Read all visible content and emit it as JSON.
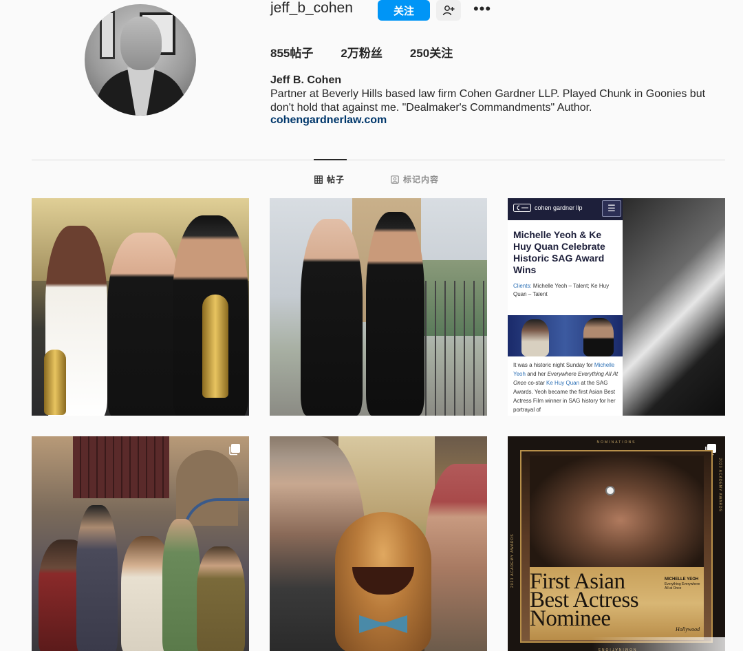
{
  "profile": {
    "username": "jeff_b_cohen",
    "follow_label": "关注",
    "stats": {
      "posts_count": "855",
      "posts_label": "帖子",
      "followers_count": "2万",
      "followers_label": "粉丝",
      "following_count": "250",
      "following_label": "关注"
    },
    "full_name": "Jeff B. Cohen",
    "bio": "Partner at Beverly Hills based law firm Cohen Gardner LLP. Played Chunk in Goonies but don't hold that against me. \"Dealmaker's Commandments\" Author.",
    "website": "cohengardnerlaw.com"
  },
  "tabs": [
    {
      "label": "帖子",
      "icon": "grid-icon",
      "active": true
    },
    {
      "label": "标记内容",
      "icon": "tagged-icon",
      "active": false
    }
  ],
  "posts": {
    "article": {
      "logo_text": "cohen gardner llp",
      "title": "Michelle Yeoh & Ke Huy Quan Celebrate Historic SAG Award Wins",
      "clients_label": "Clients:",
      "clients_text": "Michelle Yeoh – Talent; Ke Huy Quan – Talent",
      "body_1": "It was a historic night Sunday for",
      "body_link_1": "Michelle Yeoh",
      "body_2": "and her",
      "body_film": "Everywhere Everything All At Once",
      "body_3": "co-star",
      "body_link_2": "Ke Huy Quan",
      "body_4": "at the SAG Awards. Yeoh became the first Asian Best Actress Film winner in SAG history for her portrayal of"
    },
    "poster": {
      "top_label": "NOMINATIONS",
      "side_left": "2023 ACADEMY AWARDS",
      "side_right": "2023 ACADEMY AWARDS",
      "headline_1": "First Asian",
      "headline_2": "Best Actress",
      "headline_3": "Nominee",
      "name": "MICHELLE YEOH",
      "film": "Everything Everywhere All at Once",
      "brand": "Hollywood",
      "bottom_label": "NOMINATIONS"
    }
  },
  "colors": {
    "accent": "#0095f6",
    "link": "#00376b",
    "divider": "#dbdbdb"
  }
}
